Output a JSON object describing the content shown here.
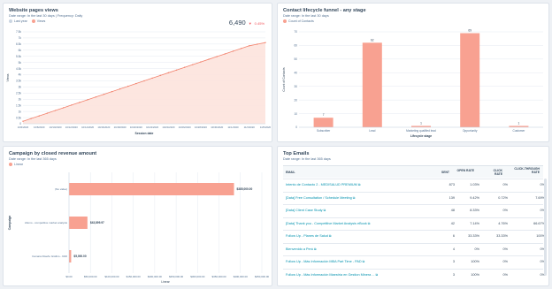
{
  "colors": {
    "accent": "#f8a191",
    "line": "#f2826d",
    "bg": "#eef1f5",
    "link": "#0091ae",
    "down": "#f2545b"
  },
  "cards": {
    "pageviews": {
      "title": "Website pages views",
      "subtitle": "Date range: In the last 30 days  |  Frequency: Daily",
      "legend": [
        "Last year",
        "Views"
      ],
      "kpi_value": "6,490",
      "kpi_change": "0.45%",
      "kpi_change_arrow": "▼",
      "chart_data": {
        "type": "area",
        "ylabel": "Views",
        "xlabel": "Session date",
        "y_ticks": [
          "0",
          "0.5k",
          "1k",
          "1.5k",
          "2k",
          "2.5k",
          "3k",
          "3.5k",
          "4k",
          "4.5k",
          "5k",
          "5.5k",
          "6k",
          "6.5k",
          "7k",
          "7.5k"
        ],
        "ylim": [
          0,
          7500
        ],
        "x_ticks": [
          "10/6/2020",
          "10/7/2020",
          "10/8/2020",
          "10/9/2020",
          "10/10/2020",
          "10/11/2020",
          "10/12/2020",
          "10/13/2020",
          "10/14/2020",
          "10/15/2020",
          "10/16/2020",
          "10/17/2020",
          "10/18/2020",
          "10/19/2020",
          "10/20/2020",
          "10/21/2020",
          "10/22/2020",
          "10/23/2020",
          "10/24/2020",
          "10/25/2020",
          "10/26/2020",
          "10/27/2020",
          "10/28/2020",
          "10/29/2020",
          "10/30/2020",
          "10/31/2020",
          "11/1/2020",
          "11/2/2020",
          "11/3/2020",
          "11/4/2020",
          "11/5/2020"
        ],
        "series": [
          {
            "name": "Views",
            "values": [
              200,
              420,
              640,
              860,
              1080,
              1300,
              1520,
              1740,
              1960,
              2180,
              2400,
              2620,
              2840,
              3060,
              3280,
              3500,
              3720,
              3940,
              4160,
              4380,
              4600,
              4820,
              5040,
              5260,
              5480,
              5700,
              5920,
              6140,
              6360,
              6490,
              6620
            ]
          }
        ]
      }
    },
    "funnel": {
      "title": "Contact lifecycle funnel - any stage",
      "subtitle": "Date range: In the last 30 days",
      "legend": [
        "Count of Contacts"
      ],
      "chart_data": {
        "type": "bar",
        "ylabel": "Count of Contacts",
        "xlabel": "Lifecycle stage",
        "categories": [
          "Subscriber",
          "Lead",
          "Marketing qualified lead",
          "Opportunity",
          "Customer"
        ],
        "values": [
          7,
          62,
          1,
          69,
          1
        ],
        "value_labels": [
          "7",
          "62",
          "1",
          "69",
          "1"
        ],
        "y_ticks": [
          "0",
          "10",
          "20",
          "30",
          "40",
          "50",
          "60",
          "70"
        ],
        "ylim": [
          0,
          70
        ]
      }
    },
    "campaign": {
      "title": "Campaign by closed revenue amount",
      "subtitle": "Date range: In the last 365 days",
      "legend": [
        "Linear"
      ],
      "chart_data": {
        "type": "bar",
        "orientation": "horizontal",
        "ylabel": "Campaign",
        "xlabel": "Linear",
        "categories": [
          "(No value)",
          "Abono - competitive market analysis",
          "Camara Diseño Gráfico - 9/20"
        ],
        "values": [
          385000,
          43000,
          5000
        ],
        "value_labels": [
          "$385,000.00",
          "$43,899.97",
          "$5,000.00"
        ],
        "x_ticks": [
          "$0.00",
          "$50,000.00",
          "$100,000.00",
          "$150,000.00",
          "$200,000.00",
          "$250,000.00",
          "$300,000.00",
          "$350,000.00",
          "$400,000.00",
          "$450,000.00"
        ],
        "xlim": [
          0,
          450000
        ]
      }
    },
    "emails": {
      "title": "Top Emails",
      "subtitle": "Date range: In the last 365 days",
      "headers": [
        "EMAIL",
        "SENT",
        "OPEN RATE",
        "CLICK RATE",
        "CLICK-THROUGH RATE"
      ],
      "rows": [
        [
          "Intento de Contacto 2 - MEDISALUD PREMIUM",
          "873",
          "1.03%",
          "0%",
          "0%"
        ],
        [
          "[Data] Free Consultation / Schedule Meeting",
          "139",
          "9.42%",
          "0.72%",
          "7.69%"
        ],
        [
          "[Data] Client Case Study",
          "48",
          "8.33%",
          "0%",
          "0%"
        ],
        [
          "[Data] Thank you - Competitive Market Analysis eBook",
          "42",
          "7.14%",
          "4.76%",
          "66.67%"
        ],
        [
          "Follow Up - Planes de Salud",
          "6",
          "33.33%",
          "33.33%",
          "100%"
        ],
        [
          "Bienvenido a Perú",
          "4",
          "0%",
          "0%",
          "0%"
        ],
        [
          "Follow Up - Más Información MBA Part Time - PAD",
          "3",
          "100%",
          "0%",
          "0%"
        ],
        [
          "Follow Up - Más Información Maestría en Gestion Minera ...",
          "3",
          "100%",
          "0%",
          "0%"
        ]
      ]
    }
  }
}
